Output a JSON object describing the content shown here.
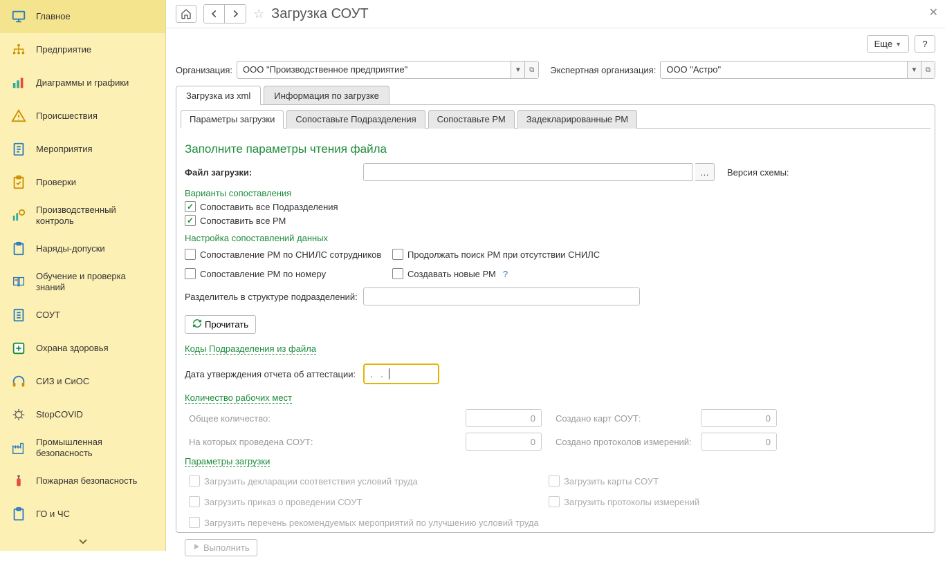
{
  "sidebar": {
    "items": [
      {
        "label": "Главное"
      },
      {
        "label": "Предприятие"
      },
      {
        "label": "Диаграммы и графики"
      },
      {
        "label": "Происшествия"
      },
      {
        "label": "Мероприятия"
      },
      {
        "label": "Проверки"
      },
      {
        "label": "Производственный контроль"
      },
      {
        "label": "Наряды-допуски"
      },
      {
        "label": "Обучение и проверка знаний"
      },
      {
        "label": "СОУТ"
      },
      {
        "label": "Охрана здоровья"
      },
      {
        "label": "СИЗ и СиОС"
      },
      {
        "label": "StopCOVID"
      },
      {
        "label": "Промышленная безопасность"
      },
      {
        "label": "Пожарная безопасность"
      },
      {
        "label": "ГО и ЧС"
      }
    ]
  },
  "header": {
    "title": "Загрузка СОУТ",
    "more_label": "Еще",
    "help_label": "?"
  },
  "org": {
    "label": "Организация:",
    "value": "ООО \"Производственное предприятие\"",
    "expert_label": "Экспертная организация:",
    "expert_value": "ООО \"Астро\""
  },
  "outer_tabs": [
    "Загрузка из xml",
    "Информация по загрузке"
  ],
  "inner_tabs": [
    "Параметры загрузки",
    "Сопоставьте Подразделения",
    "Сопоставьте РМ",
    "Задекларированные РМ"
  ],
  "params": {
    "section_title": "Заполните параметры чтения файла",
    "file_label": "Файл загрузки:",
    "file_value": "",
    "version_label": "Версия схемы:",
    "variants_title": "Варианты сопоставления",
    "match_all_depts": "Сопоставить все Подразделения",
    "match_all_rm": "Сопоставить все РМ",
    "settings_title": "Настройка сопоставлений данных",
    "chk_snils": "Сопоставление РМ по СНИЛС сотрудников",
    "chk_continue": "Продолжать поиск РМ при отсутствии СНИЛС",
    "chk_number": "Сопоставление РМ по номеру",
    "chk_create": "Создавать новые РМ",
    "separator_label": "Разделитель в структуре подразделений:",
    "separator_value": "",
    "read_btn": "Прочитать",
    "codes_link": "Коды Подразделения из файла",
    "date_label": "Дата утверждения отчета об аттестации:",
    "date_value": ".   .",
    "count_title": "Количество рабочих мест",
    "total_label": "Общее количество:",
    "total_value": "0",
    "created_cards_label": "Создано карт СОУТ:",
    "created_cards_value": "0",
    "sout_done_label": "На которых проведена СОУТ:",
    "sout_done_value": "0",
    "protocols_label": "Создано протоколов измерений:",
    "protocols_value": "0",
    "load_title": "Параметры загрузки",
    "chk_decl": "Загрузить декларации соответствия условий труда",
    "chk_cards": "Загрузить карты СОУТ",
    "chk_order": "Загрузить приказ о проведении СОУТ",
    "chk_proto": "Загрузить протоколы измерений",
    "chk_recom": "Загрузить перечень рекомендуемых мероприятий по улучшению условий труда",
    "run_btn": "Выполнить"
  }
}
